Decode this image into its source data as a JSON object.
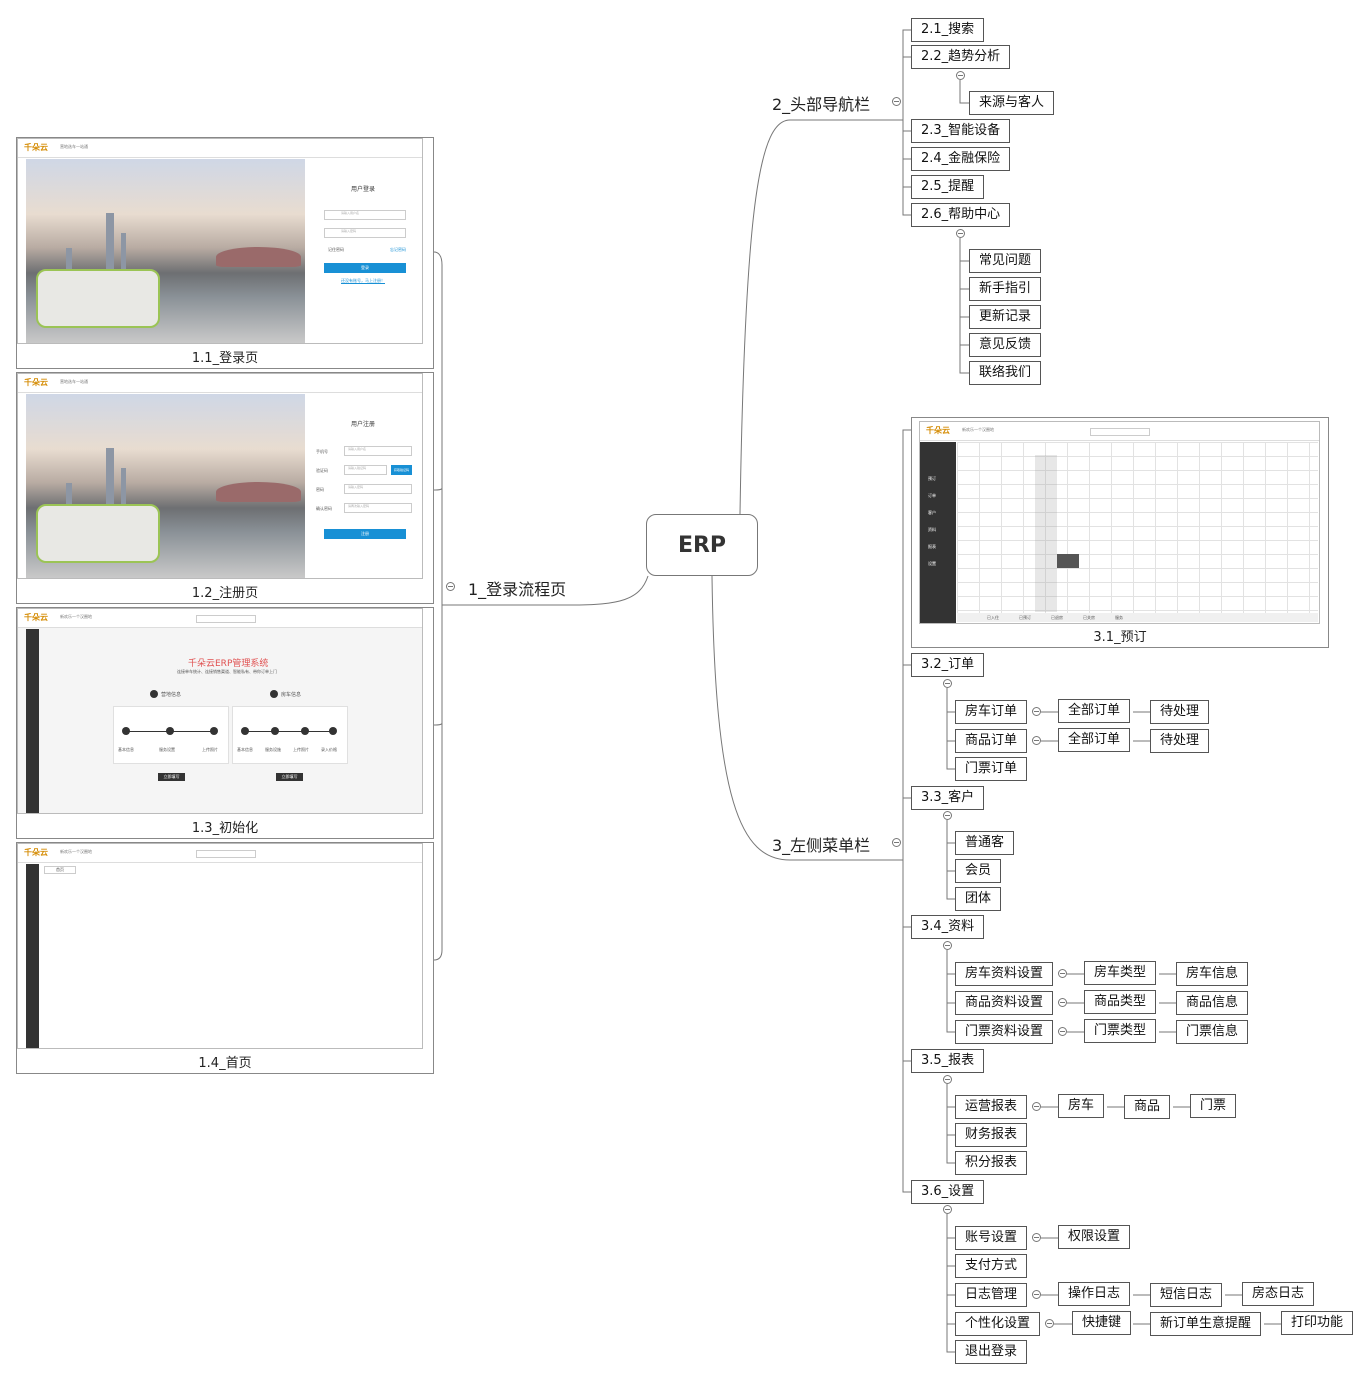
{
  "root": {
    "label": "ERP"
  },
  "branches": {
    "b1": {
      "label": "1_登录流程页"
    },
    "b2": {
      "label": "2_头部导航栏"
    },
    "b3": {
      "label": "3_左侧菜单栏"
    }
  },
  "screens": {
    "login": {
      "caption": "1.1_登录页",
      "logo": "千朵云",
      "logo_sub": "营地选车一站通",
      "title": "用户登录",
      "username_ph": "请输入用户名",
      "password_ph": "请输入密码",
      "remember": "记住密码",
      "forgot": "忘记密码",
      "button": "登录",
      "register_link": "还没有账号，马上注册！"
    },
    "register": {
      "caption": "1.2_注册页",
      "logo": "千朵云",
      "logo_sub": "营地选车一站通",
      "title": "用户注册",
      "phone_label": "手机号",
      "code_label": "验证码",
      "password_label": "密码",
      "confirm_label": "确认密码",
      "phone_ph": "请输入用户名",
      "code_ph": "请输入验证码",
      "password_ph": "请输入密码",
      "confirm_ph": "请再次输入密码",
      "code_button": "获取验证码",
      "button": "注册"
    },
    "init": {
      "caption": "1.3_初始化",
      "logo": "千朵云",
      "header_text": "新欢乐一个汉圈地",
      "title": "千朵云ERP管理系统",
      "subtitle": "连接单车统计、连接销售渠道、智能私有、带你订单上门",
      "step1": "营地信息",
      "step2": "房车信息",
      "step1_labels": [
        "基本信息",
        "服务设置",
        "上传照片"
      ],
      "step2_labels": [
        "基本信息",
        "服务设施",
        "上传照片",
        "录入价格"
      ],
      "button": "立即填写"
    },
    "home": {
      "caption": "1.4_首页",
      "logo": "千朵云",
      "header_text": "新欢乐一个汉圈地",
      "tab": "首页"
    },
    "booking": {
      "caption": "3.1_预订",
      "logo": "千朵云",
      "header_text": "新欢乐一个汉圈地",
      "menu": [
        "预订",
        "订单",
        "客户",
        "资料",
        "报表",
        "设置"
      ],
      "date_cell": "2017-08-21",
      "dates": [
        "08-19",
        "08-20",
        "今天",
        "08-22",
        "08-23",
        "08-24",
        "08-25",
        "08-26",
        "08-27",
        "08-28",
        "08-29",
        "08-30",
        "08-31",
        "09-01",
        "07-02"
      ],
      "row_labels": [
        "房型A",
        "房型B",
        "房型C",
        "",
        "",
        "",
        "",
        "",
        "",
        "",
        "豪华房"
      ],
      "legend": [
        "已入住",
        "已预订",
        "已退房",
        "已关房",
        "服务"
      ]
    }
  },
  "nav_nodes": {
    "n21": "2.1_搜索",
    "n22": "2.2_趋势分析",
    "n22a": "来源与客人",
    "n23": "2.3_智能设备",
    "n24": "2.4_金融保险",
    "n25": "2.5_提醒",
    "n26": "2.6_帮助中心",
    "n26a": "常见问题",
    "n26b": "新手指引",
    "n26c": "更新记录",
    "n26d": "意见反馈",
    "n26e": "联络我们"
  },
  "menu_nodes": {
    "n32": "3.2_订单",
    "n32a": "房车订单",
    "n32a1": "全部订单",
    "n32a2": "待处理",
    "n32b": "商品订单",
    "n32b1": "全部订单",
    "n32b2": "待处理",
    "n32c": "门票订单",
    "n33": "3.3_客户",
    "n33a": "普通客",
    "n33b": "会员",
    "n33c": "团体",
    "n34": "3.4_资料",
    "n34a": "房车资料设置",
    "n34a1": "房车类型",
    "n34a2": "房车信息",
    "n34b": "商品资料设置",
    "n34b1": "商品类型",
    "n34b2": "商品信息",
    "n34c": "门票资料设置",
    "n34c1": "门票类型",
    "n34c2": "门票信息",
    "n35": "3.5_报表",
    "n35a": "运营报表",
    "n35a1": "房车",
    "n35a2": "商品",
    "n35a3": "门票",
    "n35b": "财务报表",
    "n35c": "积分报表",
    "n36": "3.6_设置",
    "n36a": "账号设置",
    "n36a1": "权限设置",
    "n36b": "支付方式",
    "n36c": "日志管理",
    "n36c1": "操作日志",
    "n36c2": "短信日志",
    "n36c3": "房态日志",
    "n36d": "个性化设置",
    "n36d1": "快捷键",
    "n36d2": "新订单生意提醒",
    "n36d3": "打印功能",
    "n36e": "退出登录"
  }
}
